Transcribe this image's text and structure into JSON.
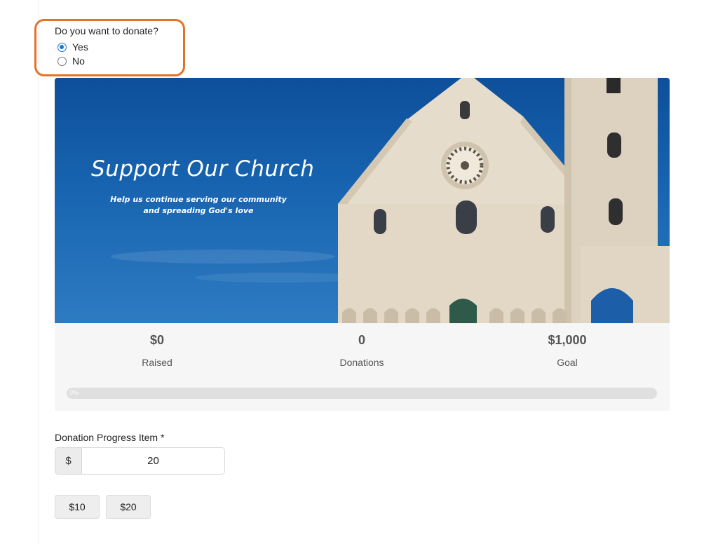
{
  "question": {
    "label": "Do you want to donate?",
    "options": [
      {
        "label": "Yes",
        "checked": true
      },
      {
        "label": "No",
        "checked": false
      }
    ]
  },
  "banner": {
    "title": "Support Our Church",
    "subtitle_line1": "Help us continue serving our community",
    "subtitle_line2": "and spreading God's love"
  },
  "stats": {
    "raised": {
      "value": "$0",
      "label": "Raised"
    },
    "donations": {
      "value": "0",
      "label": "Donations"
    },
    "goal": {
      "value": "$1,000",
      "label": "Goal"
    },
    "progress_text": "0%",
    "progress_fraction": 0
  },
  "donation_field": {
    "label": "Donation Progress Item *",
    "currency_symbol": "$",
    "value": "20"
  },
  "presets": [
    "$10",
    "$20"
  ],
  "colors": {
    "highlight": "#e0742b",
    "radio_accent": "#1a73e8",
    "sky": "#1864b0"
  }
}
